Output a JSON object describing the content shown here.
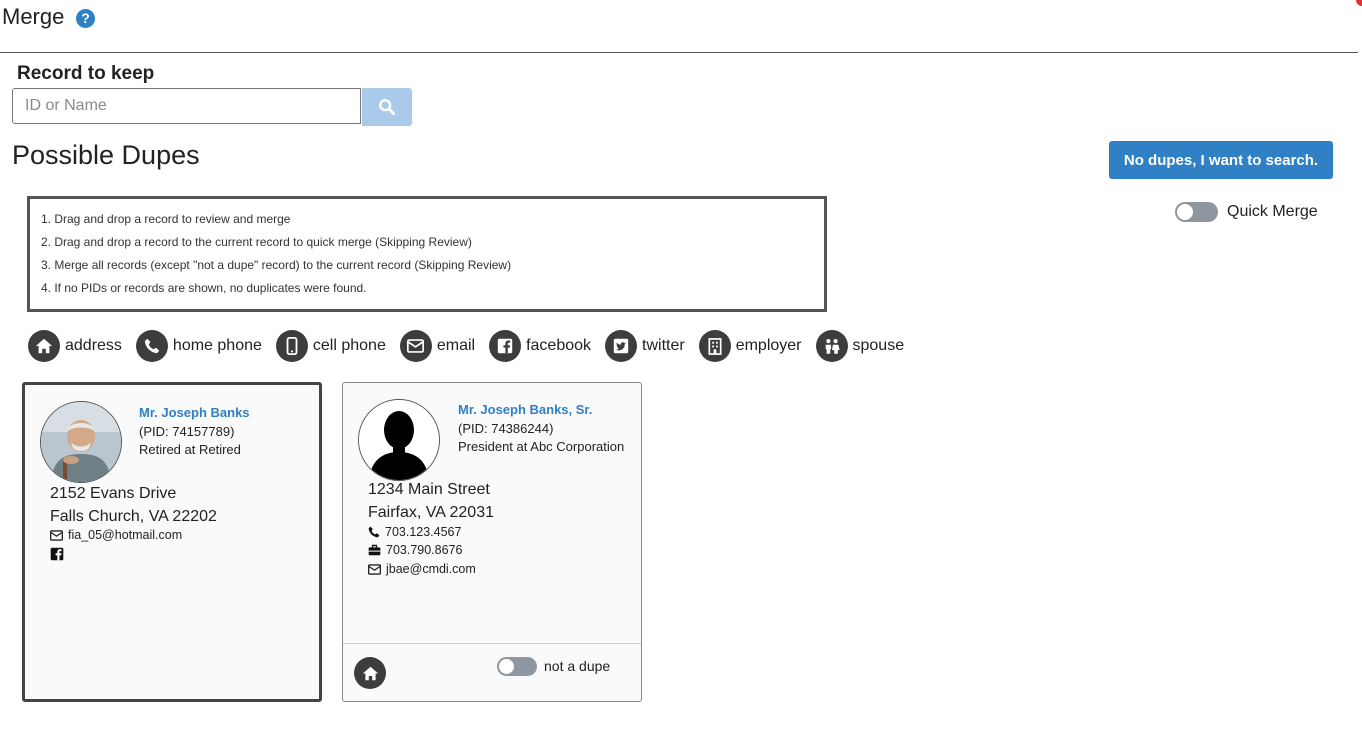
{
  "header": {
    "title": "Merge",
    "help_icon": "question-circle-icon"
  },
  "record_to_keep": {
    "label": "Record to keep",
    "placeholder": "ID or Name",
    "value": "",
    "search_icon": "search-icon"
  },
  "possible_dupes": {
    "heading": "Possible Dupes",
    "no_dupes_label": "No dupes, I want to search."
  },
  "instructions": [
    "1. Drag and drop a record to review and merge",
    "2. Drag and drop a record to the current record to quick merge (Skipping Review)",
    "3. Merge all records (except \"not a dupe\" record) to the current record (Skipping Review)",
    "4. If no PIDs or records are shown, no duplicates were found."
  ],
  "quick_merge": {
    "label": "Quick Merge",
    "on": false
  },
  "filters": [
    {
      "label": "address",
      "icon": "home-icon"
    },
    {
      "label": "home phone",
      "icon": "phone-icon"
    },
    {
      "label": "cell phone",
      "icon": "mobile-icon"
    },
    {
      "label": "email",
      "icon": "envelope-icon"
    },
    {
      "label": "facebook",
      "icon": "facebook-icon"
    },
    {
      "label": "twitter",
      "icon": "twitter-icon"
    },
    {
      "label": "employer",
      "icon": "building-icon"
    },
    {
      "label": "spouse",
      "icon": "couple-icon"
    }
  ],
  "records": [
    {
      "name": "Mr. Joseph Banks",
      "pid": "(PID: 74157789)",
      "job": "Retired at Retired",
      "address1": "2152 Evans Drive",
      "address2": "Falls Church, VA 22202",
      "email": "fia_05@hotmail.com",
      "facebook_icon": "facebook-icon"
    },
    {
      "name": "Mr. Joseph Banks, Sr.",
      "pid": "(PID: 74386244)",
      "job": "President at Abc Corporation",
      "address1": "1234 Main Street",
      "address2": "Fairfax, VA 22031",
      "home_phone": "703.123.4567",
      "work_phone": "703.790.8676",
      "email": "jbae@cmdi.com",
      "not_a_dupe_label": "not a dupe",
      "not_a_dupe_on": false
    }
  ],
  "colors": {
    "accent": "#2f80c4",
    "search_button": "#a9cbe9",
    "icon_circle": "#3d3d3d",
    "toggle_off": "#8e969f"
  }
}
